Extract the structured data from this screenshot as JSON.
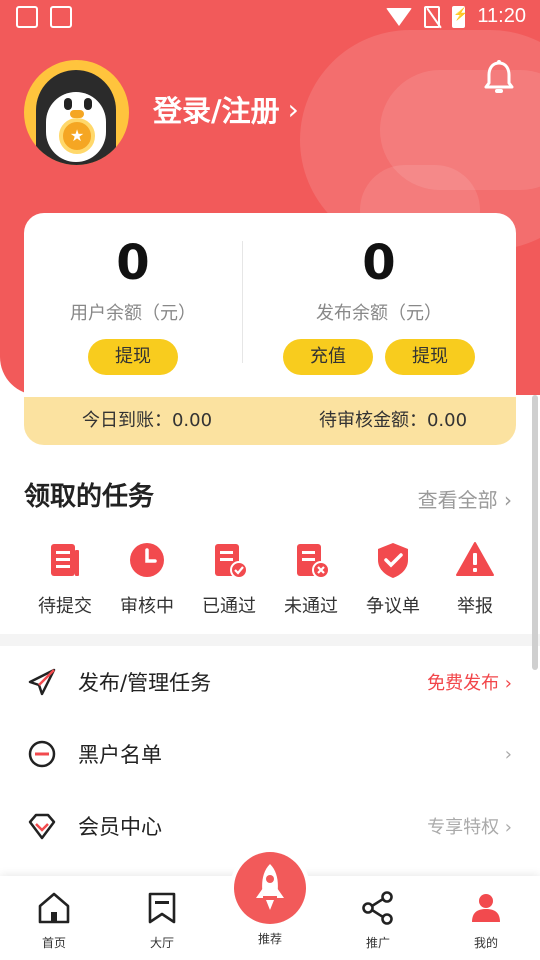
{
  "status_bar": {
    "time": "11:20"
  },
  "profile": {
    "login_text": "登录/注册",
    "chevron": "›"
  },
  "balance": {
    "user_amount": "0",
    "user_label": "用户余额（元）",
    "user_button": "提现",
    "publish_amount": "0",
    "publish_label": "发布余额（元）",
    "recharge_button": "充值",
    "publish_withdraw_button": "提现",
    "today_arrival": "今日到账：0.00",
    "pending_review": "待审核金额：0.00"
  },
  "tasks": {
    "title": "领取的任务",
    "view_all": "查看全部 ›",
    "items": [
      {
        "label": "待提交",
        "icon": "document-icon"
      },
      {
        "label": "审核中",
        "icon": "clock-icon"
      },
      {
        "label": "已通过",
        "icon": "approved-doc-icon"
      },
      {
        "label": "未通过",
        "icon": "rejected-doc-icon"
      },
      {
        "label": "争议单",
        "icon": "shield-check-icon"
      },
      {
        "label": "举报",
        "icon": "warning-icon"
      }
    ]
  },
  "menu": [
    {
      "label": "发布/管理任务",
      "right": "免费发布 ›",
      "icon": "paper-plane-icon"
    },
    {
      "label": "黑户名单",
      "right": "›",
      "icon": "minus-circle-icon"
    },
    {
      "label": "会员中心",
      "right": "专享特权 ›",
      "icon": "diamond-icon"
    }
  ],
  "bottom_nav": [
    {
      "label": "首页",
      "icon": "home-icon"
    },
    {
      "label": "大厅",
      "icon": "bookmark-icon"
    },
    {
      "label": "推荐",
      "icon": "rocket-icon"
    },
    {
      "label": "推广",
      "icon": "share-icon"
    },
    {
      "label": "我的",
      "icon": "user-icon"
    }
  ],
  "colors": {
    "primary": "#f25a5a",
    "accent_yellow": "#f8cc1e",
    "strip": "#fbe2a0",
    "promo_red": "#f2464a"
  }
}
